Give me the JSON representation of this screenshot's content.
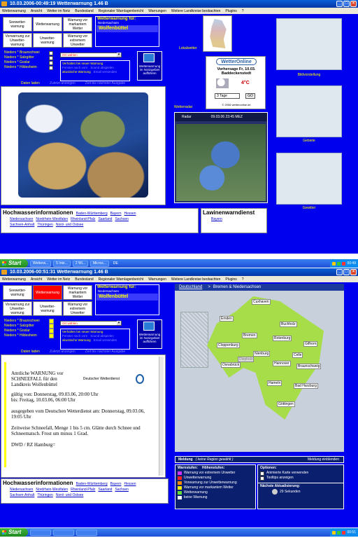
{
  "win1": {
    "title": "10.03.2006-00:49:19 Wetterwarnung 1.46 B",
    "menu": [
      "Wetterwarnung",
      "Ansicht",
      "Wetter im Netz",
      "Bundesland",
      "Regionaler Warnlagenbericht",
      "Warnungen",
      "Weitere Landkreise beobachten",
      "Plugins",
      "?"
    ],
    "cells": [
      "Seewetter-warnung",
      "Wetterwarnung",
      "Warnung vor markantem Wetter",
      "Vorwarnung zur Unwetter-warnung",
      "Unwetter-warnung",
      "Warnung vor extremem Unwetter"
    ],
    "warnbox": {
      "title": "Wetterwarnung für:",
      "region": "Niedersachsen",
      "city": "Wolfenbüttel"
    },
    "nieders": [
      "Nieders * Braunschwei",
      "Nieders * Salzgitter",
      "Nieders * Goslar",
      "Nieders * Hildesheim"
    ],
    "ort_placeholder": "Ort wählen",
    "verhalten": {
      "title": "Verhalten bei neuer Warnung",
      "items": [
        "Fenster nach vorn",
        "Sound abspielen",
        "akustische Warnung",
        "Email versenden"
      ]
    },
    "notify_label": "Wetterwarnung im Notizgebiet aufführen",
    "nav": [
      "Daten laden",
      "Zuletzt anzeigen",
      "Zeit bis nächster Ausgabe"
    ],
    "lokalwetter": "Lokalwetter",
    "wetteronline": {
      "logo": "WetterOnline",
      "forecast": "Vorhersage Fr, 10.03. Baddeckenstedt",
      "temp": "4°C",
      "days": "3 Tage",
      "go": "GO",
      "copy": "© 2006 wetteronline.de"
    },
    "radar": {
      "label": "Wetterradar",
      "brand": "Radar",
      "time": "09.03.06 23:45 MEZ"
    },
    "thumbs": [
      "Bildvorstellung",
      "Gebiete",
      "Gewitter"
    ],
    "hochwasser": {
      "title": "Hochwasserinformationen",
      "links": [
        "Baden-Württemberg",
        "Bayern",
        "Hessen",
        "Niedersachsen",
        "Nordrhein-Westfalen",
        "Rheinland-Pfalz",
        "Saarland",
        "Sachsen",
        "Sachsen-Anhalt",
        "Thüringen",
        "Nord- und Ostsee"
      ]
    },
    "lawinen": {
      "title": "Lawinenwarndienst",
      "link": "Bayern"
    }
  },
  "task1": {
    "start": "Start",
    "buttons": [
      "Wetterw...",
      "5 Inte...",
      "2 Wi...",
      "Micros..."
    ],
    "lang": "DE",
    "clock": "00:49"
  },
  "win2": {
    "title": "10.03.2006-00:51:31 Wetterwarnung 1.46 B",
    "cells": [
      "Seewetter-warnung",
      "Wetterwarnung",
      "Warnung vor markantem Wetter",
      "Vorwarnung zur Unwetter-warnung",
      "Unwetter-warnung",
      "Warnung vor extremem Unwetter"
    ],
    "nieders": [
      "Nieders * Braunschwei",
      "Nieders * Salzgitter",
      "Nieders * Goslar",
      "Nieders * Hildesheim"
    ],
    "breadcrumb": [
      "Deutschland",
      ">",
      "Bremen & Niedersachsen"
    ],
    "cities": [
      "Cuxhaven",
      "Emden",
      "Buchholz",
      "Bremen",
      "Rotenburg",
      "Celle",
      "Cloppenburg",
      "Nienburg",
      "Braunschweig",
      "Osnabrück",
      "Gifhorn",
      "Hannover",
      "Hameln",
      "Göttingen",
      "Bad Harzburg",
      "Diepholz"
    ],
    "warning": {
      "heading": "Amtliche WARNUNG vor SCHNEEFALL für den Landkreis Wolfenbüttel",
      "dwd": "Deutscher Wetterdienst",
      "valid_from": "gültig von: Donnerstag, 09.03.06, 20:00 Uhr",
      "valid_to": "bis: Freitag, 10.03.06, 06:00 Uhr",
      "issued": "ausgegeben vom Deutschen Wetterdienst am: Donnerstag, 09.03.06, 19:05 Uhr",
      "body": "Zeitweise Schneefall, Menge 1 bis 5 cm. Glätte durch Schnee und Schneematsch. Frost um minus 1 Grad.",
      "footer": "DWD / RZ Hamburg="
    },
    "meldung": {
      "label": "Meldung",
      "value": "( keine Region gewählt )",
      "einblenden": "Meldung einblenden"
    },
    "legend": {
      "tab1": "Warnstufen:",
      "tab2": "Höhenstufen:",
      "items": [
        {
          "t": "Warnung vor extremem Unwetter",
          "c": "#cc33ff"
        },
        {
          "t": "Unwetterwarnung",
          "c": "#ff2222"
        },
        {
          "t": "Vorwarnung zur Unwetterwarnung",
          "c": "#ff8800"
        },
        {
          "t": "Warnung vor markantem Wetter",
          "c": "#ffee00"
        },
        {
          "t": "Wetterwarnung",
          "c": "#66dd33"
        },
        {
          "t": "keine Warnung",
          "c": "#ffffff"
        }
      ]
    },
    "optionen": {
      "title": "Optionen:",
      "items": [
        "Animierte Karte verwenden",
        "Tooltips anzeigen"
      ]
    },
    "aktualisierung": {
      "title": "Nächste Aktualisierung:",
      "value": "29 Sekunden"
    }
  },
  "task2": {
    "start": "Start",
    "clock": "00:51"
  }
}
